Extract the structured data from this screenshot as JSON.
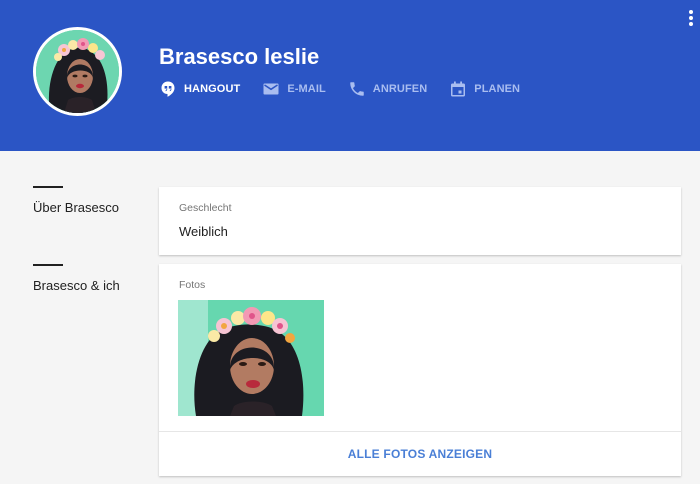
{
  "profile": {
    "name": "Brasesco leslie",
    "avatar_icon": "profile-photo"
  },
  "actions": [
    {
      "label": "HANGOUT",
      "icon": "hangouts-icon",
      "active": true
    },
    {
      "label": "E-MAIL",
      "icon": "mail-icon",
      "active": false
    },
    {
      "label": "ANRUFEN",
      "icon": "phone-icon",
      "active": false
    },
    {
      "label": "PLANEN",
      "icon": "calendar-icon",
      "active": false
    }
  ],
  "sections": {
    "about": "Über Brasesco",
    "you_and": "Brasesco & ich"
  },
  "about_card": {
    "label": "Geschlecht",
    "value": "Weiblich"
  },
  "photos_card": {
    "label": "Fotos",
    "show_all": "ALLE FOTOS ANZEIGEN"
  },
  "colors": {
    "header": "#2b55c5",
    "link": "#4a7fd6",
    "background": "#f5f5f5"
  }
}
